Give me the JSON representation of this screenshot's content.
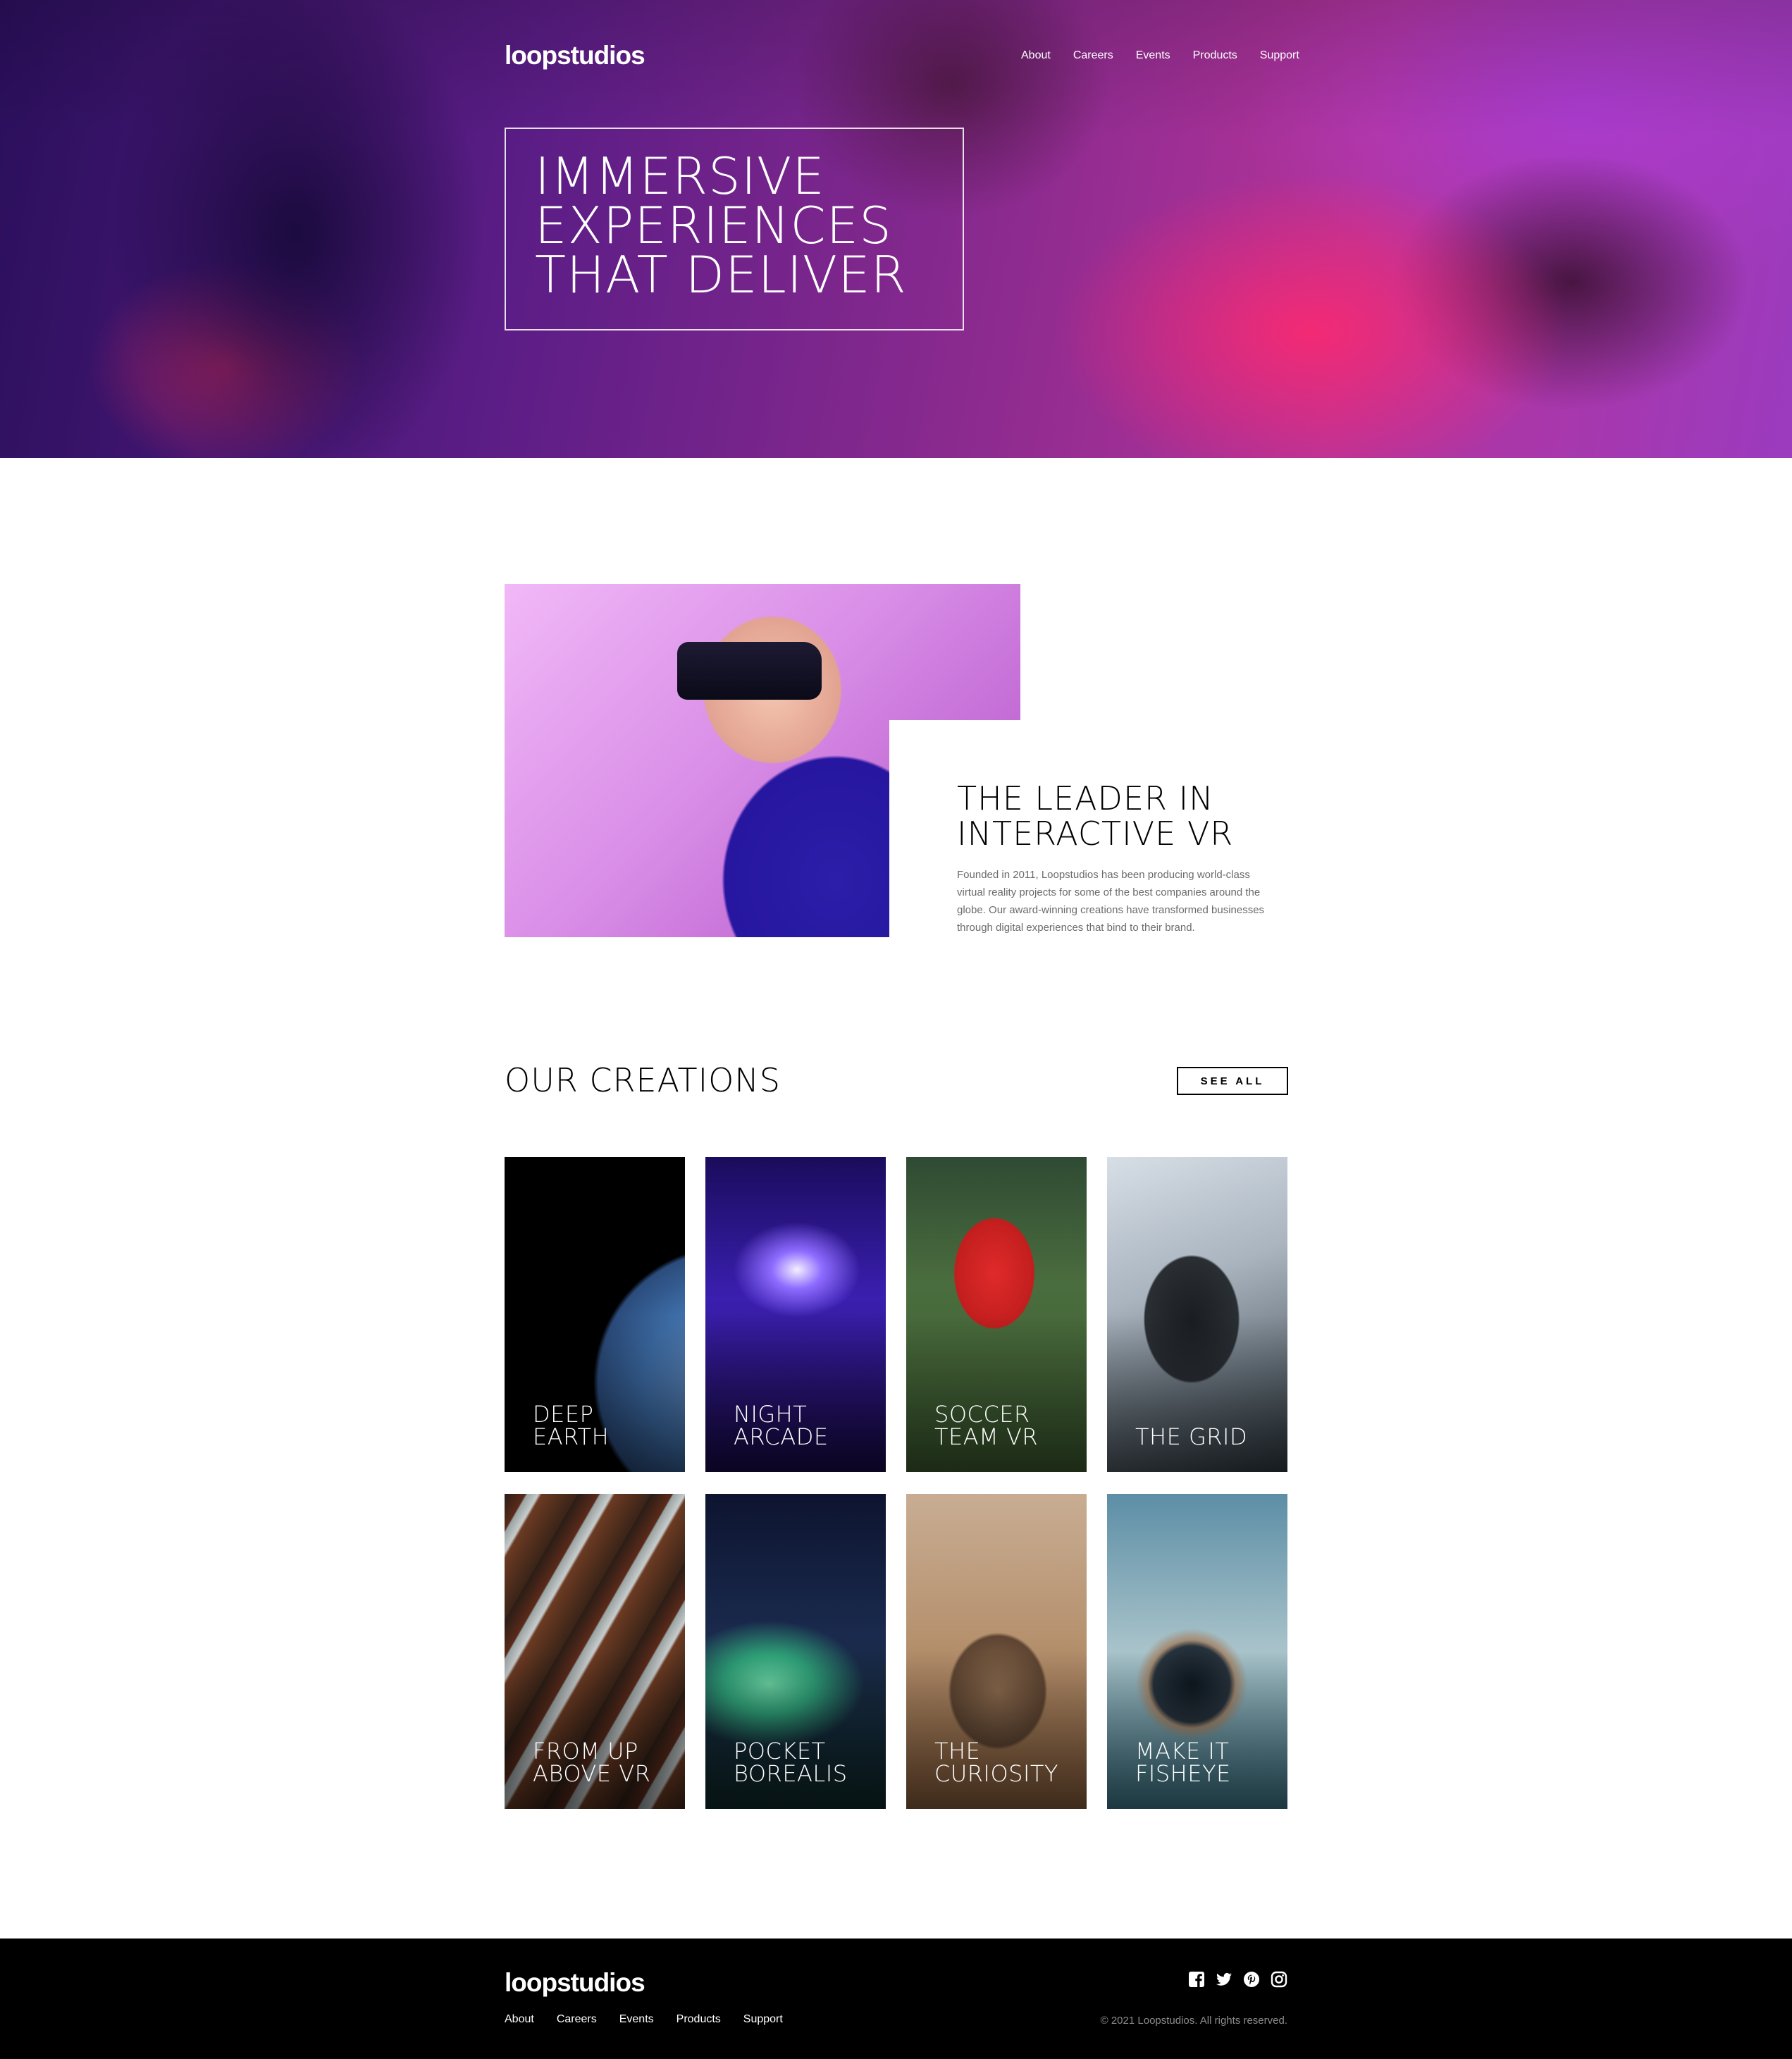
{
  "header": {
    "logo": "loopstudios",
    "nav": [
      "About",
      "Careers",
      "Events",
      "Products",
      "Support"
    ]
  },
  "hero": {
    "title": "IMMERSIVE\nEXPERIENCES\nTHAT DELIVER"
  },
  "leader": {
    "title": "THE LEADER IN\nINTERACTIVE VR",
    "text": "Founded in 2011, Loopstudios has been producing world-class virtual reality projects for some of the best companies around the globe. Our award-winning creations have transformed businesses through digital experiences that bind to their brand."
  },
  "creations": {
    "title": "OUR CREATIONS",
    "see_all": "SEE ALL",
    "items": [
      {
        "title": "DEEP\nEARTH"
      },
      {
        "title": "NIGHT\nARCADE"
      },
      {
        "title": "SOCCER\nTEAM VR"
      },
      {
        "title": "THE GRID"
      },
      {
        "title": "FROM UP\nABOVE VR"
      },
      {
        "title": "POCKET\nBOREALIS"
      },
      {
        "title": "THE\nCURIOSITY"
      },
      {
        "title": "MAKE IT\nFISHEYE"
      }
    ]
  },
  "footer": {
    "logo": "loopstudios",
    "nav": [
      "About",
      "Careers",
      "Events",
      "Products",
      "Support"
    ],
    "social_icons": [
      "facebook-icon",
      "twitter-icon",
      "pinterest-icon",
      "instagram-icon"
    ],
    "copyright": "© 2021 Loopstudios. All rights reserved."
  }
}
